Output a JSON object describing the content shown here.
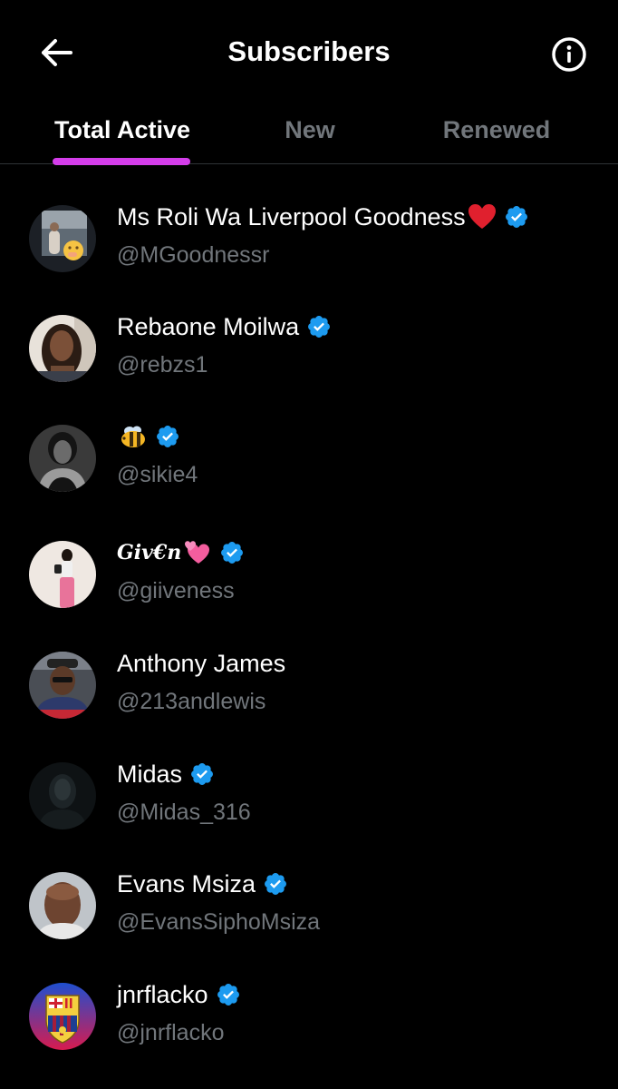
{
  "header": {
    "title": "Subscribers",
    "back_icon": "arrow-left-icon",
    "info_icon": "info-circle-icon"
  },
  "tabs": [
    {
      "label": "Total Active",
      "active": true
    },
    {
      "label": "New",
      "active": false
    },
    {
      "label": "Renewed",
      "active": false
    }
  ],
  "colors": {
    "background": "#000000",
    "tab_indicator": "#d43dea",
    "verified": "#1d9bf0",
    "secondary_text": "#71767b"
  },
  "subscribers": [
    {
      "name": "Ms Roli Wa Liverpool Goodness",
      "emoji": "heart-emoji",
      "verified": true,
      "handle": "@MGoodnessr"
    },
    {
      "name": "Rebaone Moilwa",
      "verified": true,
      "handle": "@rebzs1"
    },
    {
      "name": "",
      "emoji": "bee-emoji",
      "verified": true,
      "handle": "@sikie4"
    },
    {
      "name": "Giv€n",
      "emoji": "two-hearts-emoji",
      "verified": true,
      "handle": "@giiveness"
    },
    {
      "name": "Anthony James",
      "verified": false,
      "handle": "@213andlewis"
    },
    {
      "name": "Midas",
      "verified": true,
      "handle": "@Midas_316"
    },
    {
      "name": "Evans Msiza",
      "verified": true,
      "handle": "@EvansSiphoMsiza"
    },
    {
      "name": "jnrflacko",
      "verified": true,
      "handle": "@jnrflacko"
    }
  ]
}
